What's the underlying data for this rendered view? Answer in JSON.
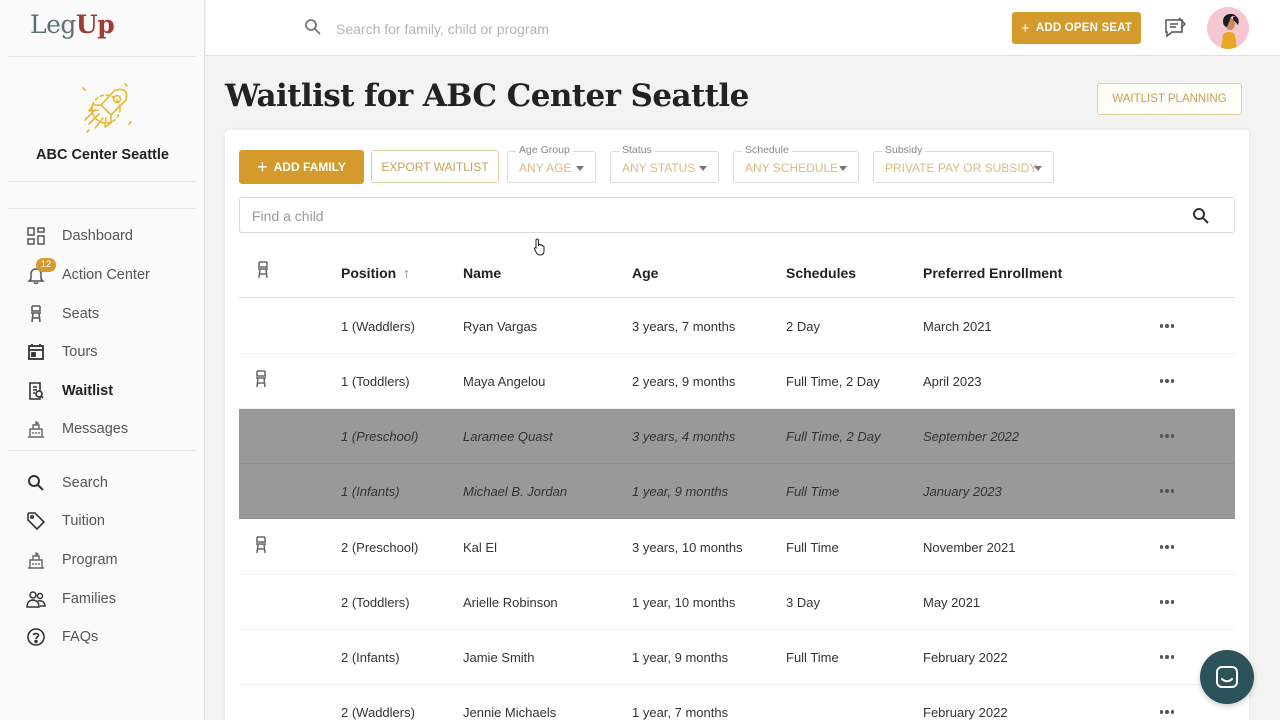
{
  "brand": {
    "logo_leg": "Leg",
    "logo_up": "Up"
  },
  "center": {
    "name": "ABC Center Seattle"
  },
  "nav": [
    {
      "label": "Dashboard",
      "icon": "dashboard-icon"
    },
    {
      "label": "Action Center",
      "icon": "bell-icon",
      "badge": "12"
    },
    {
      "label": "Seats",
      "icon": "seat-icon"
    },
    {
      "label": "Tours",
      "icon": "calendar-icon"
    },
    {
      "label": "Waitlist",
      "icon": "waitlist-icon",
      "active": true
    },
    {
      "label": "Messages",
      "icon": "building-icon"
    },
    {
      "label": "Search",
      "icon": "search-icon"
    },
    {
      "label": "Tuition",
      "icon": "tag-icon"
    },
    {
      "label": "Program",
      "icon": "program-icon"
    },
    {
      "label": "Families",
      "icon": "families-icon"
    },
    {
      "label": "FAQs",
      "icon": "help-icon"
    }
  ],
  "topbar": {
    "search_placeholder": "Search for family, child or program",
    "add_open_seat": "ADD OPEN SEAT"
  },
  "page": {
    "title": "Waitlist for ABC Center Seattle",
    "waitlist_planning": "WAITLIST PLANNING"
  },
  "toolbar": {
    "add_family": "ADD FAMILY",
    "export_waitlist": "EXPORT WAITLIST",
    "filters": [
      {
        "label": "Age Group",
        "value": "ANY AGE"
      },
      {
        "label": "Status",
        "value": "ANY STATUS"
      },
      {
        "label": "Schedule",
        "value": "ANY SCHEDULE"
      },
      {
        "label": "Subsidy",
        "value": "PRIVATE PAY OR SUBSIDY"
      }
    ],
    "find_placeholder": "Find a child"
  },
  "table": {
    "columns": [
      "Position",
      "Name",
      "Age",
      "Schedules",
      "Preferred Enrollment"
    ],
    "sort_indicator": "↑",
    "rows": [
      {
        "position": "1 (Waddlers)",
        "name": "Ryan Vargas",
        "age": "3 years, 7 months",
        "schedules": "2 Day",
        "enrollment": "March 2021",
        "seat_icon": false,
        "highlighted": false
      },
      {
        "position": "1 (Toddlers)",
        "name": "Maya Angelou",
        "age": "2 years, 9 months",
        "schedules": "Full Time, 2 Day",
        "enrollment": "April 2023",
        "seat_icon": true,
        "highlighted": false
      },
      {
        "position": "1 (Preschool)",
        "name": "Laramee Quast",
        "age": "3 years, 4 months",
        "schedules": "Full Time, 2 Day",
        "enrollment": "September 2022",
        "seat_icon": false,
        "highlighted": true
      },
      {
        "position": "1 (Infants)",
        "name": "Michael B. Jordan",
        "age": "1 year, 9 months",
        "schedules": "Full Time",
        "enrollment": "January 2023",
        "seat_icon": false,
        "highlighted": true
      },
      {
        "position": "2 (Preschool)",
        "name": "Kal El",
        "age": "3 years, 10 months",
        "schedules": "Full Time",
        "enrollment": "November 2021",
        "seat_icon": true,
        "highlighted": false
      },
      {
        "position": "2 (Toddlers)",
        "name": "Arielle Robinson",
        "age": "1 year, 10 months",
        "schedules": "3 Day",
        "enrollment": "May 2021",
        "seat_icon": false,
        "highlighted": false
      },
      {
        "position": "2 (Infants)",
        "name": "Jamie Smith",
        "age": "1 year, 9 months",
        "schedules": "Full Time",
        "enrollment": "February 2022",
        "seat_icon": false,
        "highlighted": false
      },
      {
        "position": "2 (Waddlers)",
        "name": "Jennie Michaels",
        "age": "1 year, 7 months",
        "schedules": "",
        "enrollment": "February 2022",
        "seat_icon": false,
        "highlighted": false
      }
    ]
  },
  "colors": {
    "accent": "#d49a2b",
    "highlight_row": "#999999",
    "chat": "#2c5359"
  }
}
